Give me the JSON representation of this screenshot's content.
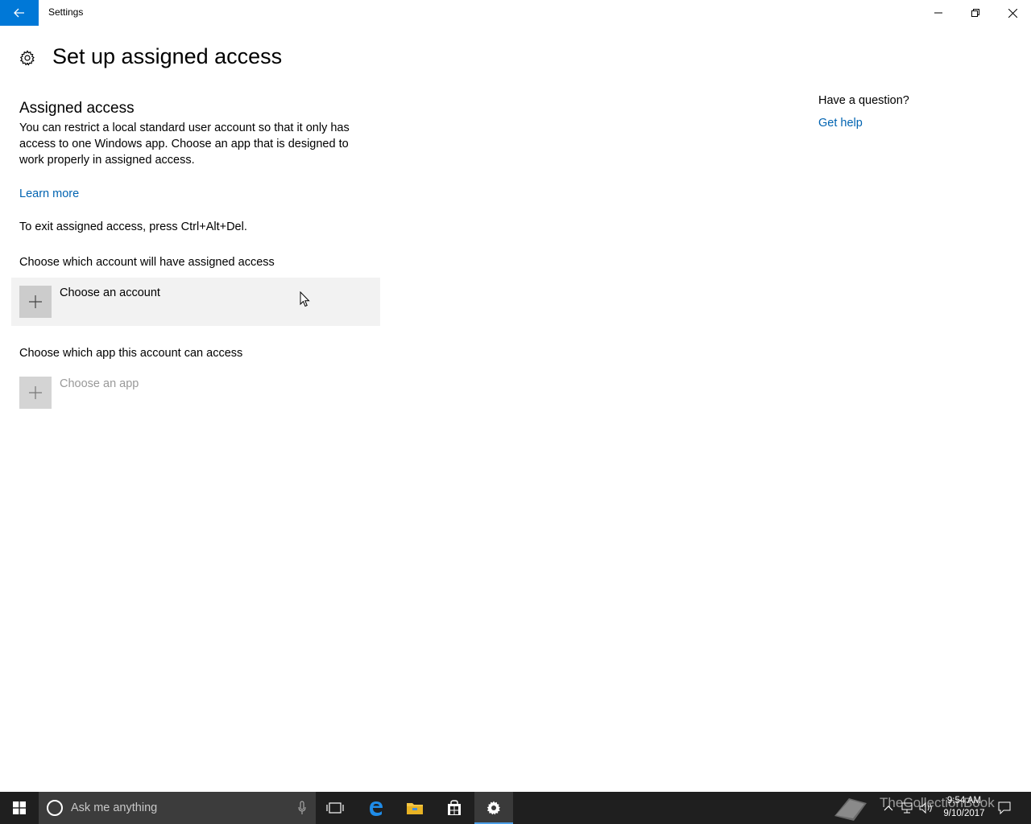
{
  "window": {
    "title": "Settings"
  },
  "page": {
    "title": "Set up assigned access"
  },
  "assigned_access": {
    "heading": "Assigned access",
    "description": "You can restrict a local standard user account so that it only has access to one Windows app. Choose an app that is designed to work properly in assigned access.",
    "learn_more": "Learn more",
    "exit_text": "To exit assigned access, press Ctrl+Alt+Del.",
    "account_label": "Choose which account will have assigned access",
    "choose_account": "Choose an account",
    "app_label": "Choose which app this account can access",
    "choose_app": "Choose an app"
  },
  "help": {
    "question": "Have a question?",
    "get_help": "Get help"
  },
  "taskbar": {
    "search_placeholder": "Ask me anything",
    "time": "9:54 AM",
    "date": "9/10/2017",
    "watermark": "TheCollectionBook"
  },
  "colors": {
    "accent": "#0078d7",
    "link": "#0063b1",
    "taskbar": "#1f1f1f"
  }
}
